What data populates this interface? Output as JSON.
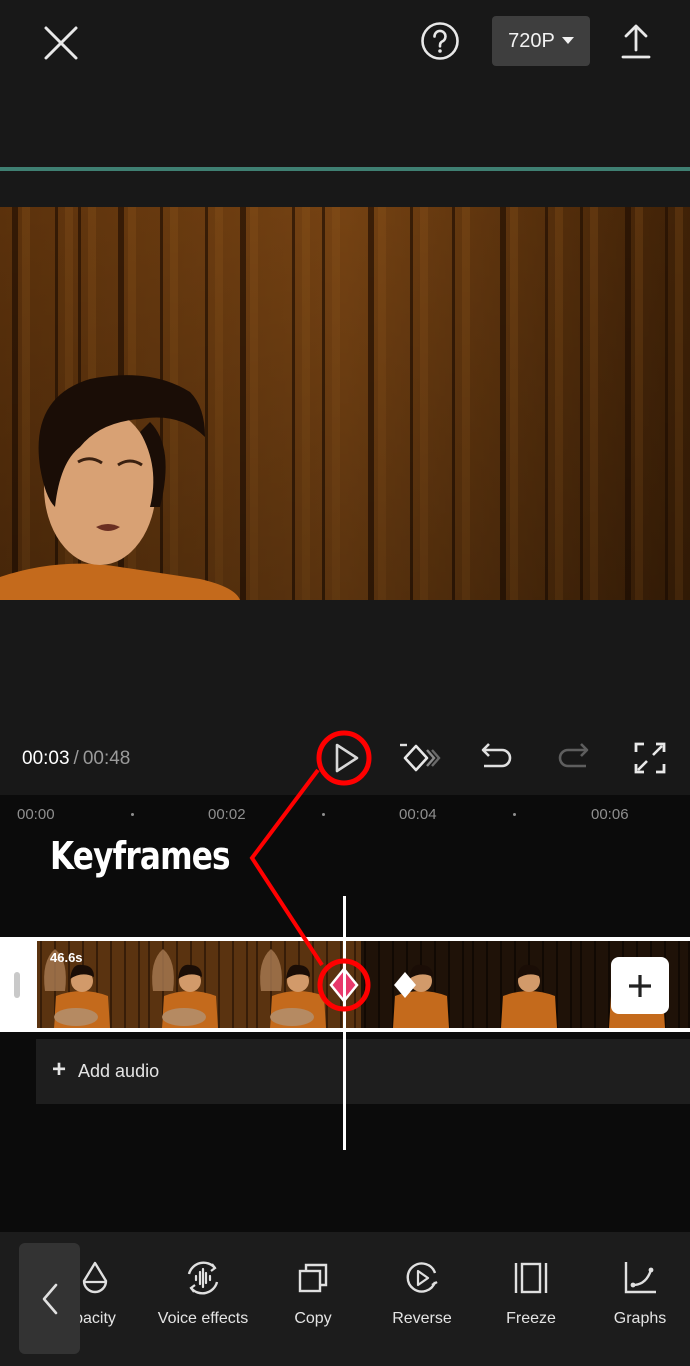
{
  "header": {
    "close_icon": "close-icon",
    "help_icon": "help-circle-icon",
    "resolution_label": "720P",
    "resolution_caret_icon": "caret-down-icon",
    "export_icon": "upload-icon",
    "accent_color": "#3f7f72"
  },
  "playback": {
    "current_time": "00:03",
    "separator": "/",
    "total_time": "00:48",
    "buttons": [
      {
        "name": "play",
        "icon": "play-icon"
      },
      {
        "name": "keyframe",
        "icon": "keyframe-icon"
      },
      {
        "name": "undo",
        "icon": "undo-icon"
      },
      {
        "name": "redo",
        "icon": "redo-icon",
        "disabled": true
      },
      {
        "name": "fullscreen",
        "icon": "fullscreen-icon"
      }
    ]
  },
  "timeline": {
    "ruler": [
      "00:00",
      "00:02",
      "00:04",
      "00:06"
    ],
    "clip_duration": "46.6s",
    "keyframes": [
      {
        "state": "selected",
        "color": "#e8386a"
      },
      {
        "state": "default",
        "color": "#ffffff"
      }
    ],
    "add_clip_icon": "plus-icon",
    "add_audio_label": "Add audio"
  },
  "annotation": {
    "label": "Keyframes",
    "color": "#ff0000"
  },
  "toolbar": {
    "back_icon": "chevron-left-icon",
    "items": [
      {
        "label": "pacity",
        "icon": "opacity-drop-icon"
      },
      {
        "label": "Voice effects",
        "icon": "voice-effects-icon"
      },
      {
        "label": "Copy",
        "icon": "copy-icon"
      },
      {
        "label": "Reverse",
        "icon": "reverse-icon"
      },
      {
        "label": "Freeze",
        "icon": "freeze-icon"
      },
      {
        "label": "Graphs",
        "icon": "graphs-icon"
      }
    ]
  }
}
